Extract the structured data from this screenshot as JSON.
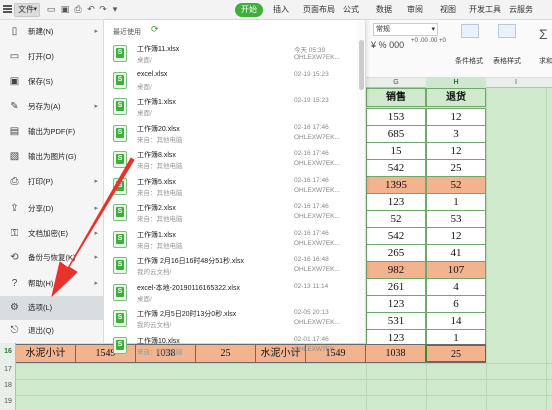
{
  "toolbar": {
    "file_menu": "文件",
    "quick_access_icons": [
      "folder-icon",
      "save-icon",
      "print-icon",
      "preview-icon",
      "undo-icon",
      "redo-icon",
      "more-icon"
    ],
    "tabs": [
      "开始",
      "插入",
      "页面布局",
      "公式",
      "数据",
      "审阅",
      "视图",
      "开发工具",
      "云服务"
    ]
  },
  "ribbon": {
    "number_format": "常规",
    "currency_symbol": "¥",
    "percent_symbol": "%",
    "thousands_symbol": "000",
    "increase_decimal": "+0 .00",
    "decrease_decimal": ".00 +0",
    "conditional_format": "条件格式",
    "table_style": "表格样式",
    "sum": "求和"
  },
  "file_menu": {
    "items": [
      {
        "label": "新建(N)",
        "icon": "new-file-icon",
        "has_arrow": true
      },
      {
        "label": "打开(O)",
        "icon": "open-folder-icon",
        "has_arrow": false
      },
      {
        "label": "保存(S)",
        "icon": "save-icon",
        "has_arrow": false
      },
      {
        "label": "另存为(A)",
        "icon": "save-as-icon",
        "has_arrow": true
      },
      {
        "label": "输出为PDF(F)",
        "icon": "pdf-icon",
        "has_arrow": false
      },
      {
        "label": "输出为图片(G)",
        "icon": "image-icon",
        "has_arrow": false
      },
      {
        "label": "打印(P)",
        "icon": "print-icon",
        "has_arrow": true
      },
      {
        "label": "分享(D)",
        "icon": "share-icon",
        "has_arrow": true
      },
      {
        "label": "文档加密(E)",
        "icon": "lock-icon",
        "has_arrow": true
      },
      {
        "label": "备份与恢复(K)",
        "icon": "backup-icon",
        "has_arrow": true
      },
      {
        "label": "帮助(H)",
        "icon": "help-icon",
        "has_arrow": true
      },
      {
        "label": "选项(L)",
        "icon": "gear-icon",
        "has_arrow": false
      },
      {
        "label": "退出(Q)",
        "icon": "exit-icon",
        "has_arrow": false
      }
    ]
  },
  "recent": {
    "title": "最近使用",
    "files": [
      {
        "name": "工作簿11.xlsx",
        "path": "桌面/",
        "time": "今天 05:39",
        "user": "OHLEXW7EK..."
      },
      {
        "name": "excel.xlsx",
        "path": "桌面/",
        "time": "02-19 15:23",
        "user": ""
      },
      {
        "name": "工作簿1.xlsx",
        "path": "桌面/",
        "time": "02-19 15:23",
        "user": ""
      },
      {
        "name": "工作簿20.xlsx",
        "path": "来自：其他电脑",
        "time": "02-16 17:46",
        "user": "OHLEXW7EK..."
      },
      {
        "name": "工作簿8.xlsx",
        "path": "来自：其他电脑",
        "time": "02-16 17:46",
        "user": "OHLEXW7EK..."
      },
      {
        "name": "工作簿5.xlsx",
        "path": "来自：其他电脑",
        "time": "02-16 17:46",
        "user": "OHLEXW7EK..."
      },
      {
        "name": "工作簿2.xlsx",
        "path": "来自：其他电脑",
        "time": "02-16 17:46",
        "user": "OHLEXW7EK..."
      },
      {
        "name": "工作簿1.xlsx",
        "path": "来自：其他电脑",
        "time": "02-16 17:46",
        "user": "OHLEXW7EK..."
      },
      {
        "name": "工作簿 2月16日16时48分51秒.xlsx",
        "path": "我的云文档/",
        "time": "02-16 16:48",
        "user": "OHLEXW7EK..."
      },
      {
        "name": "excel-本地-20190116165322.xlsx",
        "path": "桌面/",
        "time": "02-13 11:14",
        "user": ""
      },
      {
        "name": "工作簿 2月5日20时13分0秒.xlsx",
        "path": "我的云文档/",
        "time": "02-05 20:13",
        "user": "OHLEXW7EK..."
      },
      {
        "name": "工作簿10.xlsx",
        "path": "来自：其他电脑",
        "time": "02-01 17:46",
        "user": "OHLEXW7EK..."
      }
    ]
  },
  "sheet": {
    "columns": [
      "G",
      "H",
      "I"
    ],
    "headers": [
      "销售",
      "退货"
    ],
    "rows": [
      [
        "153",
        "12"
      ],
      [
        "685",
        "3"
      ],
      [
        "15",
        "12"
      ],
      [
        "542",
        "25"
      ],
      [
        "1395",
        "52"
      ],
      [
        "123",
        "1"
      ],
      [
        "52",
        "53"
      ],
      [
        "542",
        "12"
      ],
      [
        "265",
        "41"
      ],
      [
        "982",
        "107"
      ],
      [
        "261",
        "4"
      ],
      [
        "123",
        "6"
      ],
      [
        "531",
        "14"
      ],
      [
        "123",
        "1"
      ]
    ],
    "orange_rows": [
      4,
      9
    ],
    "row_numbers": [
      "16",
      "17",
      "18",
      "19"
    ],
    "total_row": [
      "水泥小计",
      "1549",
      "1038",
      "25",
      "水泥小计",
      "1549",
      "1038",
      "25"
    ]
  },
  "colors": {
    "accent_green": "#3fae3c",
    "orange_fill": "#f3b38f",
    "arrow_red": "#e8322d"
  }
}
